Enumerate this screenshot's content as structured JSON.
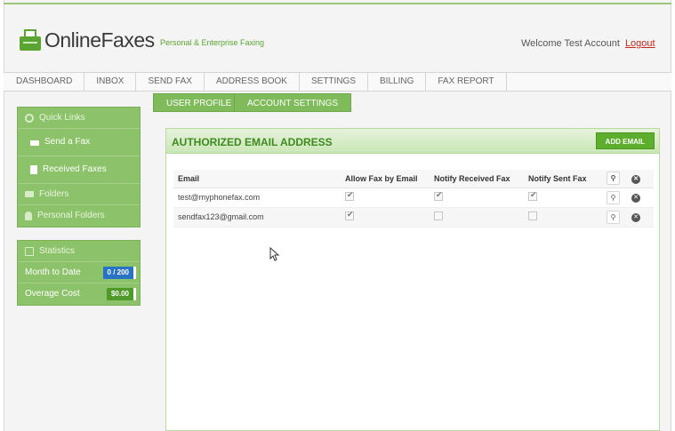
{
  "header": {
    "brand": "OnlineFaxes",
    "tagline": "Personal & Enterprise Faxing",
    "welcome": "Welcome Test Account",
    "logout": "Logout"
  },
  "nav": [
    "DASHBOARD",
    "INBOX",
    "SEND FAX",
    "ADDRESS BOOK",
    "SETTINGS",
    "BILLING",
    "FAX REPORT"
  ],
  "sidebar": {
    "quick_links": "Quick Links",
    "send_fax": "Send a Fax",
    "received_faxes": "Received Faxes",
    "folders": "Folders",
    "personal_folders": "Personal Folders",
    "statistics": "Statistics",
    "month_to_date": "Month to Date",
    "month_to_date_value": "0 / 200",
    "overage_cost": "Overage Cost",
    "overage_cost_value": "$0.00"
  },
  "tabs": [
    "USER PROFILE",
    "ACCOUNT SETTINGS"
  ],
  "card": {
    "title": "AUTHORIZED EMAIL ADDRESS",
    "add_button": "ADD EMAIL"
  },
  "table": {
    "headers": [
      "Email",
      "Allow Fax by Email",
      "Notify Received Fax",
      "Notify Sent Fax"
    ],
    "rows": [
      {
        "email": "test@myphonefax.com",
        "allow": true,
        "notify_received": true,
        "notify_sent": true
      },
      {
        "email": "sendfax123@gmail.com",
        "allow": true,
        "notify_received": false,
        "notify_sent": false
      }
    ]
  },
  "colors": {
    "accent_green": "#5aa531",
    "sidebar_green": "#8cc26a",
    "logout_red": "#c9261c",
    "badge_blue": "#2a73c4"
  }
}
